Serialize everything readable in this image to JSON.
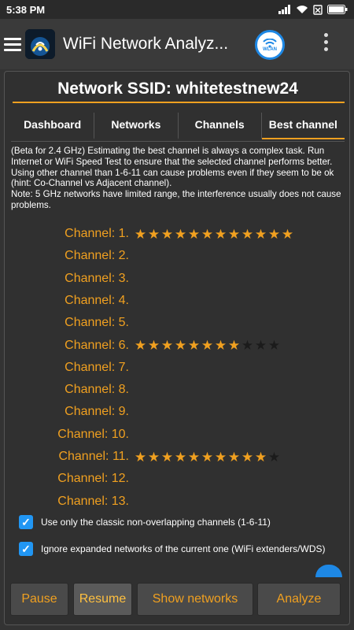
{
  "status": {
    "time": "5:38 PM"
  },
  "app": {
    "title": "WiFi Network Analyz...",
    "wlan_label": "WLAN"
  },
  "panel": {
    "ssid_title": "Network SSID: whitetestnew24",
    "tabs": [
      {
        "label": "Dashboard"
      },
      {
        "label": "Networks"
      },
      {
        "label": "Channels"
      },
      {
        "label": "Best channel",
        "active": true
      }
    ],
    "info_text": "(Beta for 2.4 GHz) Estimating the best channel is always a complex task. Run Internet or WiFi Speed Test to ensure that the selected channel performs better. Using other channel than 1-6-11 can cause problems even if they seem to be ok (hint: Co-Channel vs Adjacent channel).\nNote: 5 GHz networks have limited range, the interference usually does not cause problems.",
    "channels": [
      {
        "label": "Channel: 1.",
        "stars_on": 12,
        "stars_total": 12
      },
      {
        "label": "Channel: 2.",
        "stars_on": 0,
        "stars_total": 0
      },
      {
        "label": "Channel: 3.",
        "stars_on": 0,
        "stars_total": 0
      },
      {
        "label": "Channel: 4.",
        "stars_on": 0,
        "stars_total": 0
      },
      {
        "label": "Channel: 5.",
        "stars_on": 0,
        "stars_total": 0
      },
      {
        "label": "Channel: 6.",
        "stars_on": 8,
        "stars_total": 11
      },
      {
        "label": "Channel: 7.",
        "stars_on": 0,
        "stars_total": 0
      },
      {
        "label": "Channel: 8.",
        "stars_on": 0,
        "stars_total": 0
      },
      {
        "label": "Channel: 9.",
        "stars_on": 0,
        "stars_total": 0
      },
      {
        "label": "Channel: 10.",
        "stars_on": 0,
        "stars_total": 0
      },
      {
        "label": "Channel: 11.",
        "stars_on": 10,
        "stars_total": 11
      },
      {
        "label": "Channel: 12.",
        "stars_on": 0,
        "stars_total": 0
      },
      {
        "label": "Channel: 13.",
        "stars_on": 0,
        "stars_total": 0
      }
    ],
    "options": [
      {
        "label": "Use only the classic non-overlapping channels (1-6-11)",
        "checked": true
      },
      {
        "label": "Ignore expanded networks of the current one (WiFi extenders/WDS)",
        "checked": true
      }
    ]
  },
  "buttons": {
    "pause": "Pause",
    "resume": "Resume",
    "show_networks": "Show networks",
    "analyze": "Analyze"
  },
  "colors": {
    "accent": "#f0a020",
    "checkbox": "#2196f3",
    "background": "#333333"
  }
}
